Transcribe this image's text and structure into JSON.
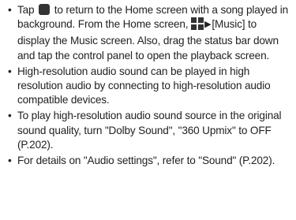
{
  "notes": [
    {
      "bullet": "•",
      "pre": "Tap",
      "post": "to return to the Home screen with a song played in background. From the Home screen,",
      "arrow": "▶",
      "menu": "[Music] to display the Music screen. Also, drag the status bar down and tap the control panel to open the playback screen."
    },
    {
      "bullet": "•",
      "text": "High-resolution audio sound can be played in high resolution audio by connecting to high-resolution audio compatible devices."
    },
    {
      "bullet": "•",
      "text": "To play high-resolution audio sound source in the original sound quality, turn \"Dolby Sound\", \"360 Upmix\" to OFF (P.202)."
    },
    {
      "bullet": "•",
      "text": "For details on \"Audio settings\", refer to \"Sound\" (P.202)."
    }
  ],
  "icons": {
    "home": "home-button-icon",
    "menu": "apps-menu-icon"
  },
  "colors": {
    "text": "#222222",
    "icon": "#333333"
  }
}
